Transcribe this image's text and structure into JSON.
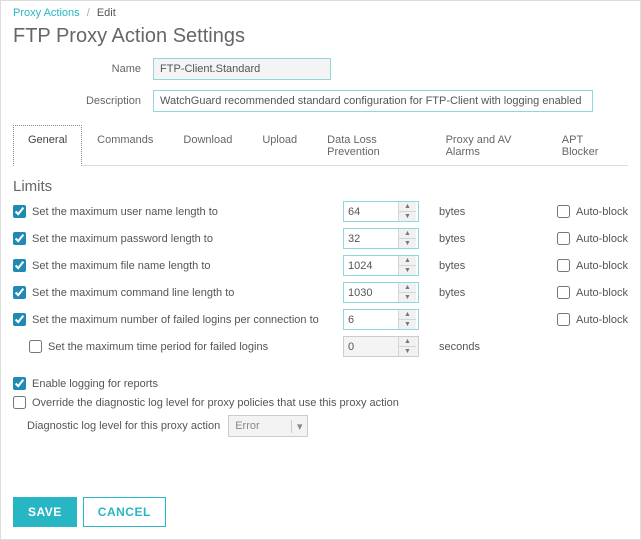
{
  "breadcrumb": {
    "link": "Proxy Actions",
    "current": "Edit"
  },
  "title": "FTP Proxy Action Settings",
  "fields": {
    "name_label": "Name",
    "name_value": "FTP-Client.Standard",
    "desc_label": "Description",
    "desc_value": "WatchGuard recommended standard configuration for FTP-Client with logging enabled"
  },
  "tabs": [
    "General",
    "Commands",
    "Download",
    "Upload",
    "Data Loss Prevention",
    "Proxy and AV Alarms",
    "APT Blocker"
  ],
  "limits": {
    "title": "Limits",
    "autoblock_label": "Auto-block",
    "rows": [
      {
        "label": "Set the maximum user name length to",
        "value": "64",
        "unit": "bytes",
        "checked": true,
        "auto": true
      },
      {
        "label": "Set the maximum password length to",
        "value": "32",
        "unit": "bytes",
        "checked": true,
        "auto": true
      },
      {
        "label": "Set the maximum file name length to",
        "value": "1024",
        "unit": "bytes",
        "checked": true,
        "auto": true
      },
      {
        "label": "Set the maximum command line length to",
        "value": "1030",
        "unit": "bytes",
        "checked": true,
        "auto": true
      },
      {
        "label": "Set the maximum number of failed logins per connection to",
        "value": "6",
        "unit": "",
        "checked": true,
        "auto": true
      },
      {
        "label": "Set the maximum time period for failed logins",
        "value": "0",
        "unit": "seconds",
        "checked": false,
        "auto": false,
        "indent": true,
        "disabled": true
      }
    ]
  },
  "logging": {
    "enable_label": "Enable logging for reports",
    "override_label": "Override the diagnostic log level for proxy policies that use this proxy action",
    "loglevel_label": "Diagnostic log level for this proxy action",
    "loglevel_value": "Error"
  },
  "buttons": {
    "save": "SAVE",
    "cancel": "CANCEL"
  }
}
